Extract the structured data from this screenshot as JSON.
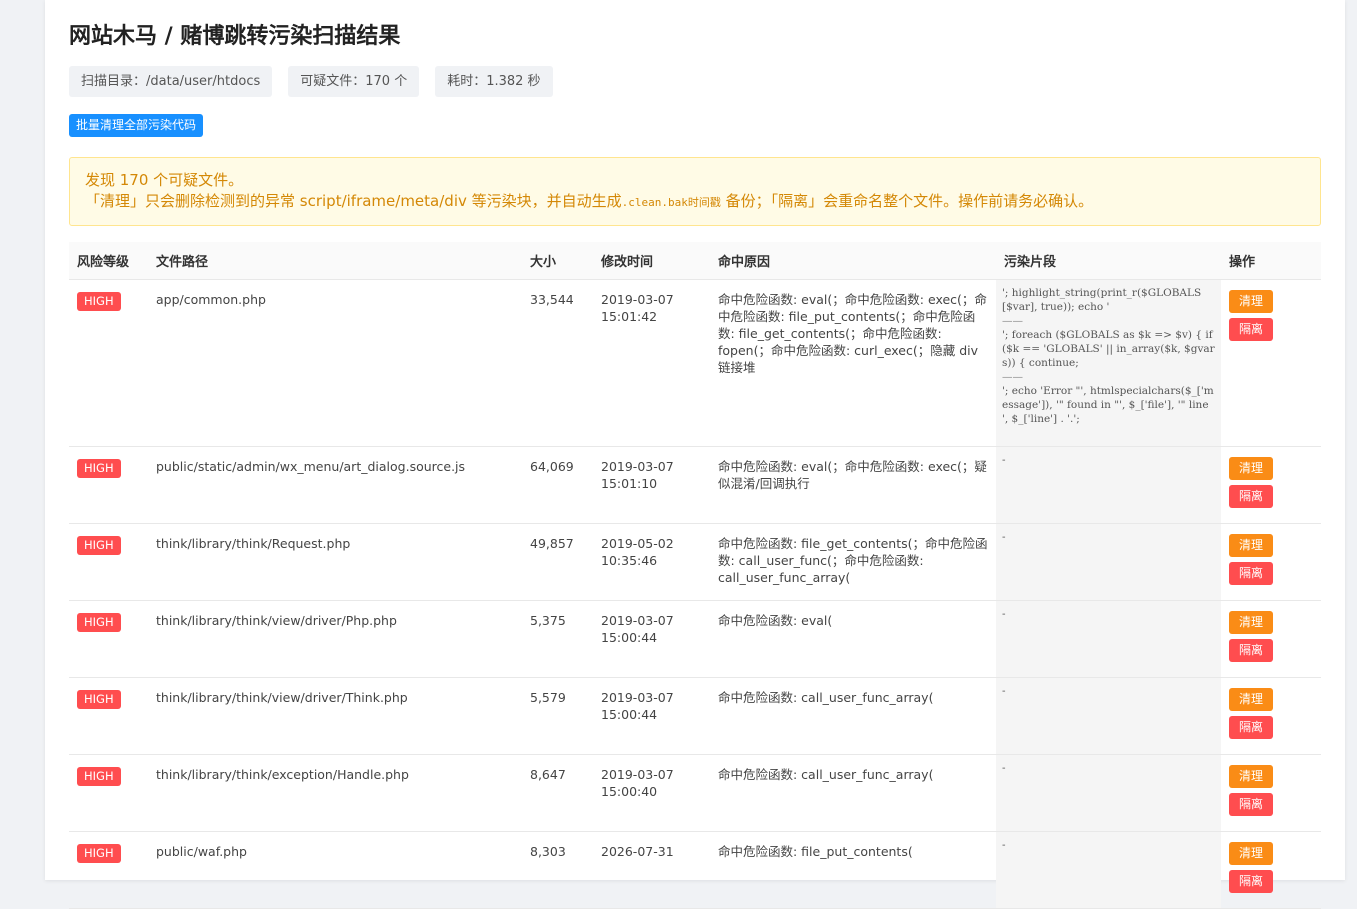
{
  "title": "网站木马 / 赌博跳转污染扫描结果",
  "chips": {
    "dir": "扫描目录：/data/user/htdocs",
    "count": "可疑文件：170 个",
    "time": "耗时：1.382 秒"
  },
  "batch_button": "批量清理全部污染代码",
  "notice": {
    "line1": "发现 170 个可疑文件。",
    "line2_a": "「清理」只会删除检测到的异常 script/iframe/meta/div 等污染块，并自动生成",
    "line2_code": ".clean.bak时间戳",
    "line2_b": "备份；「隔离」会重命名整个文件。操作前请务必确认。"
  },
  "table": {
    "headers": [
      "风险等级",
      "文件路径",
      "大小",
      "修改时间",
      "命中原因",
      "污染片段",
      "操作"
    ],
    "clean_label": "清理",
    "quarantine_label": "隔离",
    "rows": [
      {
        "level": "HIGH",
        "path": "app/common.php",
        "size": "33,544",
        "date": "2019-03-07",
        "time": "15:01:42",
        "reason": "命中危险函数: eval(；命中危险函数: exec(；命中危险函数: file_put_contents(；命中危险函数: file_get_contents(；命中危险函数: fopen(；命中危险函数: curl_exec(；隐藏 div 链接堆",
        "snippets": [
          "'; highlight_string(print_r($GLOBALS[$var], true)); echo '",
          "'; foreach ($GLOBALS as $k => $v) { if ($k == 'GLOBALS' || in_array($k, $gvars)) { continue;",
          "'; echo 'Error \"', htmlspecialchars($_['message']), '\" found in \"', $_['file'], '\" line ', $_['line'] . '.';"
        ]
      },
      {
        "level": "HIGH",
        "path": "public/static/admin/wx_menu/art_dialog.source.js",
        "size": "64,069",
        "date": "2019-03-07",
        "time": "15:01:10",
        "reason": "命中危险函数: eval(；命中危险函数: exec(；疑似混淆/回调执行",
        "snippets": [
          "-"
        ]
      },
      {
        "level": "HIGH",
        "path": "think/library/think/Request.php",
        "size": "49,857",
        "date": "2019-05-02",
        "time": "10:35:46",
        "reason": "命中危险函数: file_get_contents(；命中危险函数: call_user_func(；命中危险函数: call_user_func_array(",
        "snippets": [
          "-"
        ]
      },
      {
        "level": "HIGH",
        "path": "think/library/think/view/driver/Php.php",
        "size": "5,375",
        "date": "2019-03-07",
        "time": "15:00:44",
        "reason": "命中危险函数: eval(",
        "snippets": [
          "-"
        ]
      },
      {
        "level": "HIGH",
        "path": "think/library/think/view/driver/Think.php",
        "size": "5,579",
        "date": "2019-03-07",
        "time": "15:00:44",
        "reason": "命中危险函数: call_user_func_array(",
        "snippets": [
          "-"
        ]
      },
      {
        "level": "HIGH",
        "path": "think/library/think/exception/Handle.php",
        "size": "8,647",
        "date": "2019-03-07",
        "time": "15:00:40",
        "reason": "命中危险函数: call_user_func_array(",
        "snippets": [
          "-"
        ]
      },
      {
        "level": "HIGH",
        "path": "public/waf.php",
        "size": "8,303",
        "date": "2026-07-31",
        "time": "",
        "reason": "命中危险函数: file_put_contents(",
        "snippets": [
          "-"
        ]
      }
    ]
  },
  "colors": {
    "primary": "#1890ff",
    "danger": "#ff4d4f",
    "warning": "#fa8c16",
    "notice_bg": "#fffbe6",
    "notice_text": "#d48806"
  }
}
